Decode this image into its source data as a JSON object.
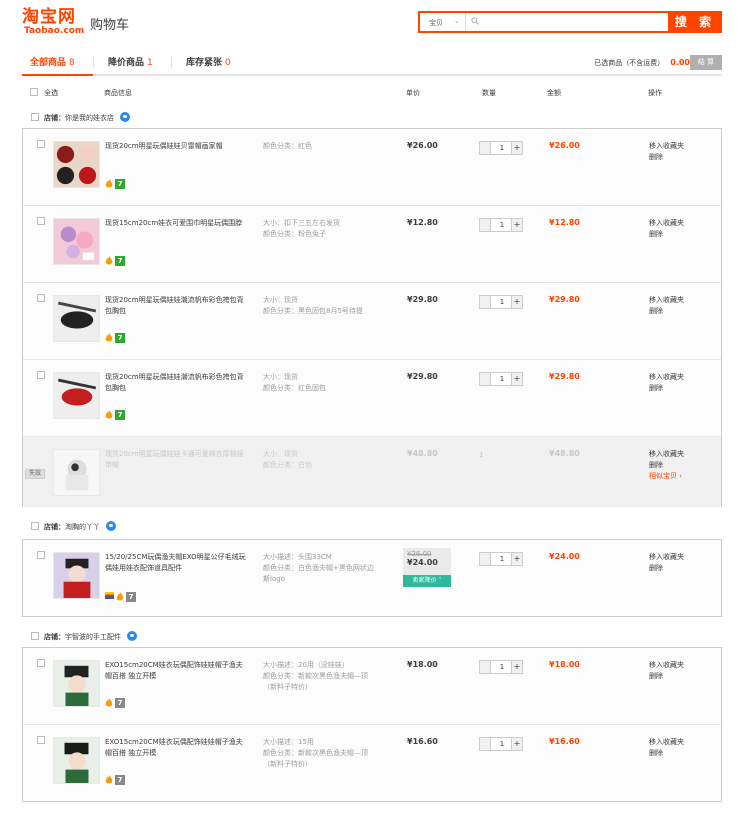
{
  "header": {
    "logo_cn": "淘宝网",
    "logo_en": "Taobao.com",
    "page_title": "购物车",
    "search": {
      "type_label": "宝贝",
      "button_label": "搜 索"
    }
  },
  "tabs": [
    {
      "label": "全部商品",
      "count": "8"
    },
    {
      "label": "降价商品",
      "count": "1"
    },
    {
      "label": "库存紧张",
      "count": "0"
    }
  ],
  "summary": {
    "selected_label": "已选商品（不含运费）",
    "amount": "0.00",
    "settle_label": "结 算"
  },
  "columns": {
    "select_all": "全选",
    "info": "商品信息",
    "unit_price": "单价",
    "quantity": "数量",
    "amount": "金额",
    "actions": "操作"
  },
  "actions": {
    "fav": "移入收藏夹",
    "delete": "删除",
    "similar": "相似宝贝 ›"
  },
  "shops": [
    {
      "prefix": "店铺：",
      "name": "你是我的娃衣店"
    },
    {
      "prefix": "店铺：",
      "name": "淘胸的丫丫"
    },
    {
      "prefix": "店铺：",
      "name": "宇智波的手工配件"
    }
  ],
  "items": [
    {
      "title": "现货20cm明星玩偶娃娃贝雷帽画家帽",
      "props": [
        "颜色分类：红色"
      ],
      "price": "¥26.00",
      "qty": "1",
      "sum": "¥26.00"
    },
    {
      "title": "现货15cm20cm娃衣可爱围巾明星玩偶围脖",
      "props": [
        "大小：扣下三五左右发货",
        "颜色分类：粉色兔子"
      ],
      "price": "¥12.80",
      "qty": "1",
      "sum": "¥12.80"
    },
    {
      "title": "现货20cm明星玩偶娃娃潮流帆布彩色挎包背包胸包",
      "props": [
        "大小：现货",
        "颜色分类：黑色固包8月5号待提"
      ],
      "price": "¥29.80",
      "qty": "1",
      "sum": "¥29.80"
    },
    {
      "title": "现货20cm明星玩偶娃娃潮流帆布彩色挎包背包胸包",
      "props": [
        "大小：现货",
        "颜色分类：红色固包"
      ],
      "price": "¥29.80",
      "qty": "1",
      "sum": "¥29.80"
    },
    {
      "title": "现货20cm明星玩偶娃娃卡通可爱棉衣厚棉服带帽",
      "props": [
        "大小：现货",
        "颜色分类：白色"
      ],
      "price": "¥48.80",
      "qty": "1",
      "sum": "¥48.80",
      "status": "失效"
    },
    {
      "title": "15/20/25CM玩偶渔夫帽EXO明星公仔毛绒玩偶娃用娃衣配饰道具配件",
      "props": [
        "大小描述：头围33CM",
        "颜色分类：白色渔夫帽+黑色网状边斯logo"
      ],
      "old_price": "¥26.00",
      "price": "¥24.00",
      "sale_tag": "卖家降价 ˅",
      "qty": "1",
      "sum": "¥24.00"
    },
    {
      "title": "EXO15cm20CM娃衣玩偶配饰娃娃帽子渔夫帽百搭 独立开模",
      "props": [
        "大小描述：20用（没娃娃）",
        "颜色分类：新款次黑色渔夫帽—顶（新料子特价）"
      ],
      "price": "¥18.00",
      "qty": "1",
      "sum": "¥18.00"
    },
    {
      "title": "EXO15cm20CM娃衣玩偶配饰娃娃帽子渔夫帽百搭 独立开模",
      "props": [
        "大小描述：15用",
        "颜色分类：新款次黑色渔夫帽—顶（新料子特价）"
      ],
      "price": "¥16.60",
      "qty": "1",
      "sum": "¥16.60"
    }
  ],
  "colors": {
    "accent": "#ff4400",
    "sale": "#2fb89a"
  }
}
